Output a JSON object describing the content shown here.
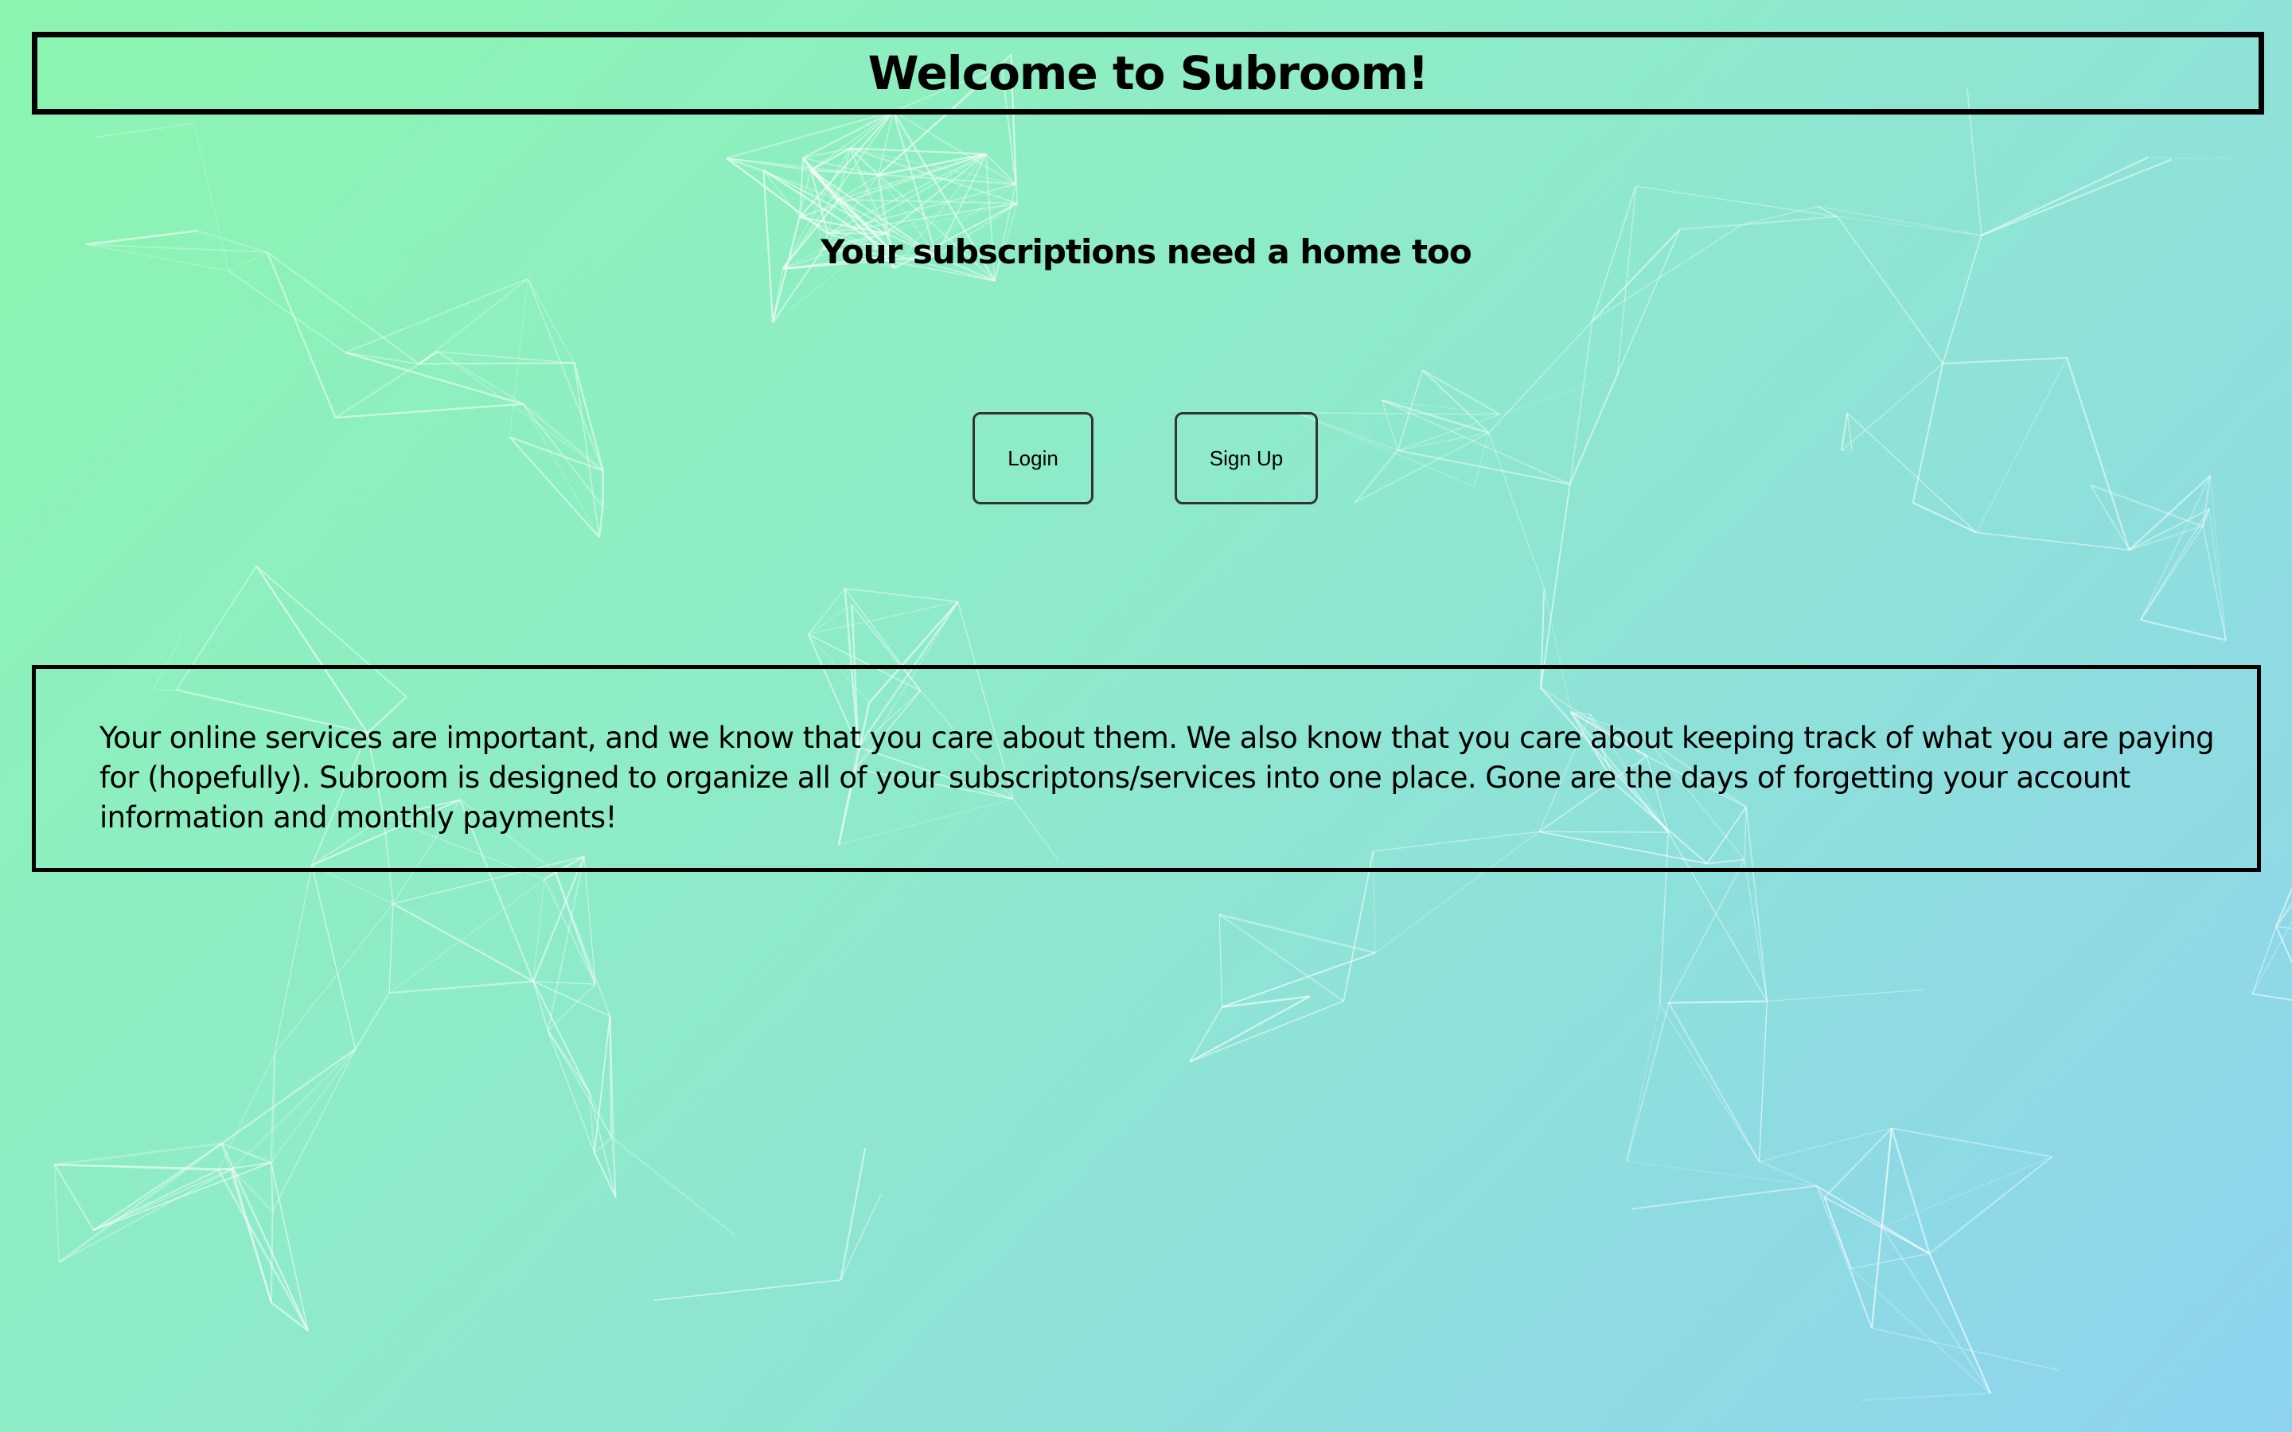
{
  "header": {
    "title": "Welcome to Subroom!"
  },
  "hero": {
    "subtitle": "Your subscriptions need a home too"
  },
  "actions": {
    "login_label": "Login",
    "signup_label": "Sign Up"
  },
  "about": {
    "text": "Your online services are important, and we know that you care about them. We also know that you care about keeping track of what you are paying for (hopefully). Subroom is designed to organize all of your subscriptons/services into one place. Gone are the days of forgetting your account information and monthly payments!"
  },
  "colors": {
    "gradient_start": "#8cf5b0",
    "gradient_end": "#8dd3f0",
    "border": "#000000",
    "network_lines": "#ffffff"
  },
  "background": {
    "pattern": "polygon-network"
  }
}
